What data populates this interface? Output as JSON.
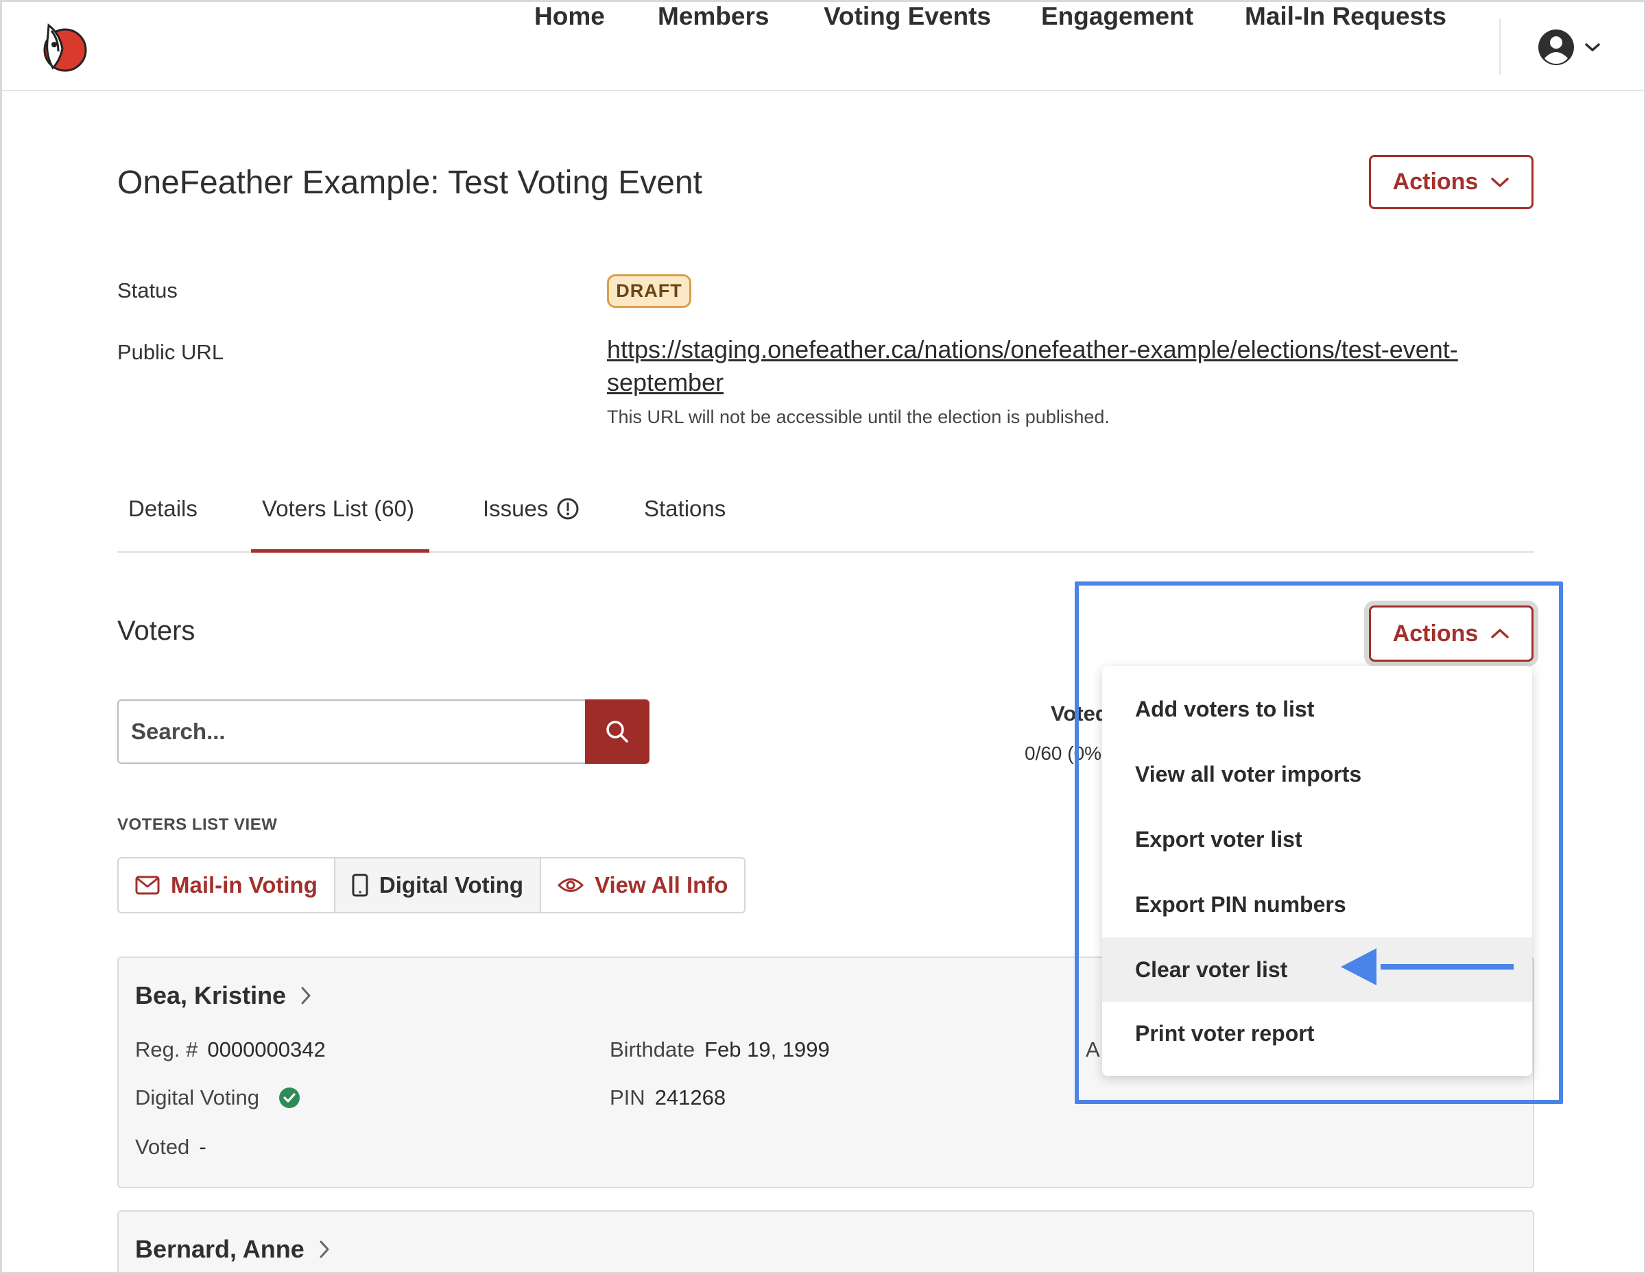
{
  "nav": {
    "items": [
      "Home",
      "Members",
      "Voting Events",
      "Engagement",
      "Mail-In Requests"
    ]
  },
  "header": {
    "title": "OneFeather Example: Test Voting Event",
    "actions_label": "Actions"
  },
  "info": {
    "status_label": "Status",
    "status_value": "DRAFT",
    "url_label": "Public URL",
    "url_value": "https://staging.onefeather.ca/nations/onefeather-example/elections/test-event-september",
    "url_note": "This URL will not be accessible until the election is published."
  },
  "tabs": [
    {
      "label": "Details"
    },
    {
      "label": "Voters List (60)"
    },
    {
      "label": "Issues"
    },
    {
      "label": "Stations"
    }
  ],
  "voters": {
    "title": "Voters",
    "actions_label": "Actions",
    "search_placeholder": "Search...",
    "voted_heading": "Voted",
    "voted_count": "0/60 (0%)",
    "view_label": "VOTERS LIST VIEW",
    "view_options": [
      "Mail-in Voting",
      "Digital Voting",
      "View All Info"
    ]
  },
  "actions_menu": {
    "items": [
      "Add voters to list",
      "View all voter imports",
      "Export voter list",
      "Export PIN numbers",
      "Clear voter list",
      "Print voter report"
    ]
  },
  "cards": [
    {
      "name": "Bea, Kristine",
      "reg_label": "Reg. #",
      "reg_value": "0000000342",
      "birth_label": "Birthdate",
      "birth_value": "Feb 19, 1999",
      "digital_label": "Digital Voting",
      "pin_label": "PIN",
      "pin_value": "241268",
      "voted_label": "Voted",
      "voted_value": "-",
      "partial_label": "A"
    },
    {
      "name": "Bernard, Anne"
    }
  ],
  "colors": {
    "brand": "#a3302c",
    "badge_bg": "#fbe8c6",
    "annotation": "#4a84e8"
  }
}
